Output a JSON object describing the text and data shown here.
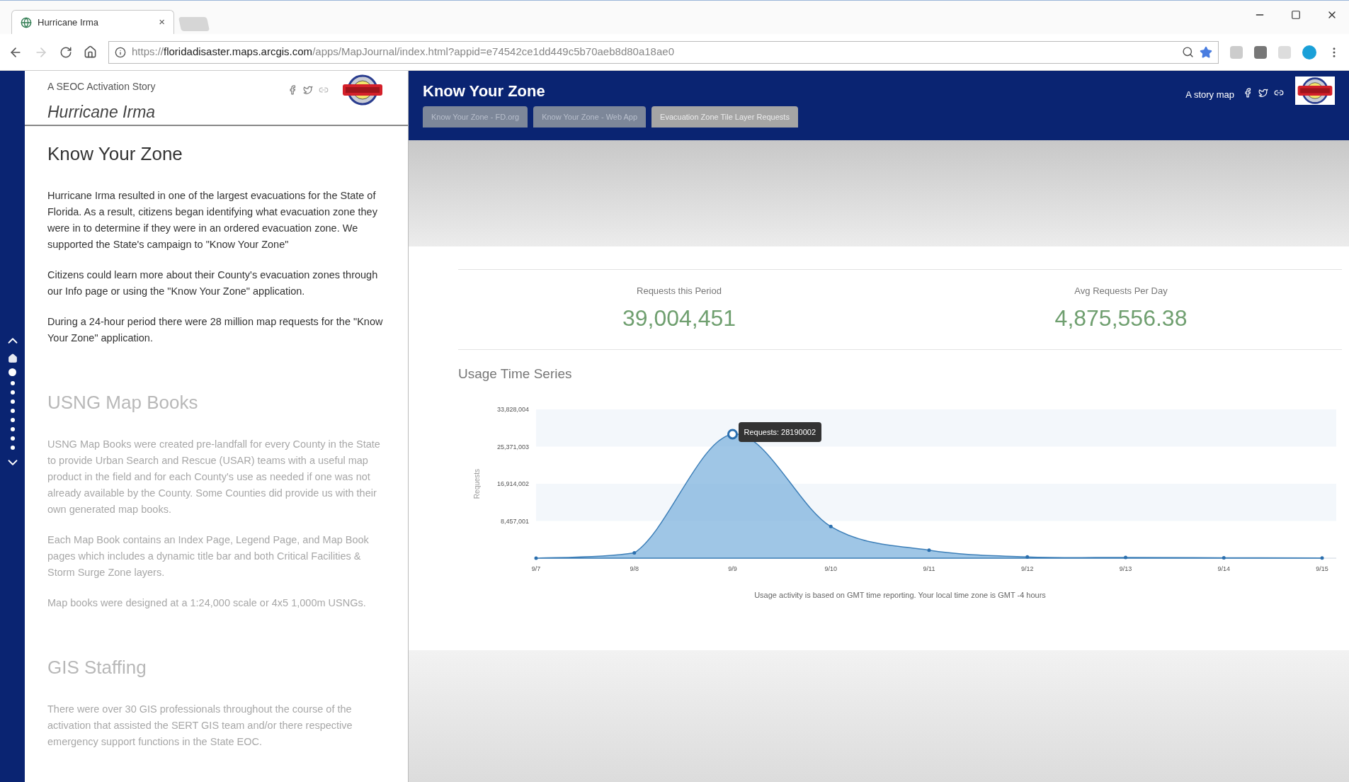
{
  "browser": {
    "tab": {
      "title": "Hurricane Irma",
      "close": "×",
      "selected": true
    },
    "url": "https://**floridadisaster.maps.arcgis.com**/apps/MapJournal/index.html?appid=e74542ce1dd449c5b70aeb8d80a18ae0"
  },
  "side_panel": {
    "subtitle": "A SEOC Activation Story",
    "title": "Hurricane Irma",
    "sections": [
      {
        "heading": "Know Your Zone",
        "active": true,
        "paragraphs": [
          "Hurricane Irma resulted in one of the largest evacuations for the State of Florida. As a result, citizens began identifying what evacuation zone they were in to determine if they were in an ordered evacuation zone. We supported the State's campaign to \"Know Your Zone\"",
          "Citizens could learn more about their County's evacuation zones through our Info page or using the \"Know Your Zone\" application.",
          "During a 24-hour period there were 28 million map requests for the \"Know Your Zone\" application."
        ]
      },
      {
        "heading": "USNG Map Books",
        "active": false,
        "paragraphs": [
          "USNG Map Books were created pre-landfall for every County in the State to provide Urban Search and Rescue (USAR) teams with a useful map product in the field and for each County's use as needed if one was not already available by the County. Some Counties did provide us with their own generated map books.",
          "Each Map Book contains an Index Page, Legend Page, and Map Book pages which includes a dynamic title bar and both Critical Facilities & Storm Surge Zone layers.",
          "Map books were designed at a 1:24,000 scale or 4x5 1,000m USNGs."
        ]
      },
      {
        "heading": "GIS Staffing",
        "active": false,
        "paragraphs": [
          "There were over 30 GIS professionals throughout the course of the activation that assisted the SERT GIS team and/or there respective emergency support functions in the State EOC."
        ]
      }
    ],
    "nav_dots": [
      {
        "kind": "home",
        "selected": false
      },
      {
        "kind": "dot",
        "selected": true
      },
      {
        "kind": "dot",
        "selected": false
      },
      {
        "kind": "dot",
        "selected": false
      },
      {
        "kind": "dot",
        "selected": false
      },
      {
        "kind": "dot",
        "selected": false
      },
      {
        "kind": "dot",
        "selected": false
      },
      {
        "kind": "dot",
        "selected": false
      },
      {
        "kind": "dot",
        "selected": false
      },
      {
        "kind": "dot",
        "selected": false
      }
    ]
  },
  "main": {
    "title": "Know Your Zone",
    "story_map_label": "A story map",
    "tabs": [
      {
        "label": "Know Your Zone - FD.org",
        "selected": false
      },
      {
        "label": "Know Your Zone - Web App",
        "selected": false
      },
      {
        "label": "Evacuation Zone Tile Layer Requests",
        "selected": true
      }
    ],
    "stats": [
      {
        "label": "Requests this Period",
        "value": "39,004,451"
      },
      {
        "label": "Avg Requests Per Day",
        "value": "4,875,556.38"
      }
    ],
    "chart_title": "Usage Time Series",
    "chart_data": {
      "type": "area",
      "ylabel": "Requests",
      "categories": [
        "9/7",
        "9/8",
        "9/9",
        "9/10",
        "9/11",
        "9/12",
        "9/13",
        "9/14",
        "9/15"
      ],
      "series": [
        {
          "color": "#7fb3dd",
          "values": [
            0,
            1200000,
            28200000,
            7200000,
            1800000,
            300000,
            150000,
            100000,
            60000
          ]
        }
      ],
      "ylim": [
        0,
        33828004
      ],
      "yticks": [
        {
          "value": 8457001,
          "label": "8,457,001"
        },
        {
          "value": 16914002,
          "label": "16,914,002"
        },
        {
          "value": 25371003,
          "label": "25,371,003"
        },
        {
          "value": 33828004,
          "label": "33,828,004"
        }
      ]
    },
    "tooltip": "Requests: 28190002",
    "footnote": "Usage activity is based on GMT time reporting. Your local time zone is GMT -4 hours"
  }
}
